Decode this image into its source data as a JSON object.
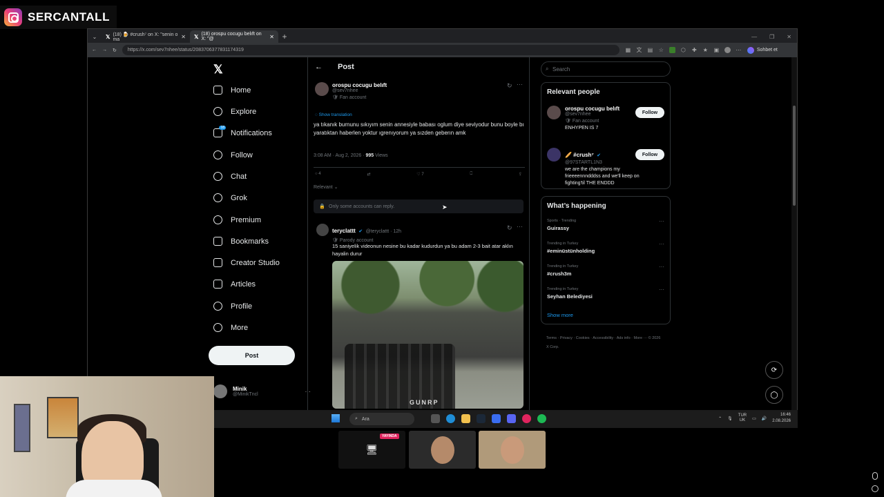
{
  "overlay": {
    "streamer": "SERCANTALL"
  },
  "browser": {
    "tabs": [
      {
        "label": "(18) 🍺 #crush⁷ on X: \"senin o ma",
        "active": false
      },
      {
        "label": "(18) orospu cocugu belıft on X: \"@",
        "active": true
      }
    ],
    "url": "https://x.com/sev7nhee/status/2083706377831174319",
    "chat_label": "Sohbet et"
  },
  "nav": {
    "items": [
      {
        "label": "Home",
        "icon": "home-icon"
      },
      {
        "label": "Explore",
        "icon": "search-icon"
      },
      {
        "label": "Notifications",
        "icon": "bell-icon",
        "badge": "18"
      },
      {
        "label": "Follow",
        "icon": "person-add-icon"
      },
      {
        "label": "Chat",
        "icon": "chat-icon"
      },
      {
        "label": "Grok",
        "icon": "grok-icon"
      },
      {
        "label": "Premium",
        "icon": "premium-icon"
      },
      {
        "label": "Bookmarks",
        "icon": "bookmark-icon"
      },
      {
        "label": "Creator Studio",
        "icon": "rocket-icon"
      },
      {
        "label": "Articles",
        "icon": "article-icon"
      },
      {
        "label": "Profile",
        "icon": "person-icon"
      },
      {
        "label": "More",
        "icon": "more-icon"
      }
    ],
    "post_label": "Post",
    "account": {
      "name": "Minik",
      "handle": "@MinikTncl"
    }
  },
  "post": {
    "header": "Post",
    "author": "orospu cocugu belıft",
    "handle": "@sev7nhee",
    "label": "Fan account",
    "show_translation": "Show translation",
    "text": "ya tıkanık burnunu sıkıyım senin annesiyle babası oglum diye seviyodur bunu boyle bı yaratıktan haberlen yoktur ıgrenıyorum ya sızden geberın amk",
    "time": "3:08 AM · Aug 2, 2026 · ",
    "views_count": "995",
    "views_label": " Views",
    "replies": "4",
    "likes": "7",
    "sort": "Relevant",
    "restricted": "Only some accounts can reply."
  },
  "reply": {
    "author": "teryclattt",
    "handle": "@teryclattt · 12h",
    "label": "Parody account",
    "text": "15 saniyelik videonun nesine bu kadar kudurdun ya bu adam 2-3 bait atar aklın hayalin durur",
    "watermark": "GUNRP"
  },
  "right": {
    "search_placeholder": "Search",
    "relevant_title": "Relevant people",
    "people": [
      {
        "name": "orospu cocugu belıft",
        "handle": "@sev7nhee",
        "label": "Fan account",
        "bio": "ENHYPEN IS 7",
        "follow": "Follow"
      },
      {
        "name": "🥖 #crush⁷",
        "handle": "@97STARTL1N3",
        "label": "",
        "bio": "we are the champions my frieeeennndddss and we'll keep on fighting'til THE ENDDD",
        "follow": "Follow"
      }
    ],
    "happening_title": "What’s happening",
    "trends": [
      {
        "context": "Sports · Trending",
        "name": "Guirassy"
      },
      {
        "context": "Trending in Turkey",
        "name": "#eminüstünholding"
      },
      {
        "context": "Trending in Turkey",
        "name": "#crush3m"
      },
      {
        "context": "Trending in Turkey",
        "name": "Seyhan Belediyesi"
      }
    ],
    "show_more": "Show more",
    "footer": "Terms · Privacy · Cookies · Accessibility · Ads info · More ··· © 2026 X Corp."
  },
  "taskbar": {
    "search": "Ara",
    "lang_top": "TUR",
    "lang_bottom": "UK",
    "time": "16:46",
    "date": "2.08.2026"
  },
  "call": {
    "live_badge": "YAYINDA"
  }
}
